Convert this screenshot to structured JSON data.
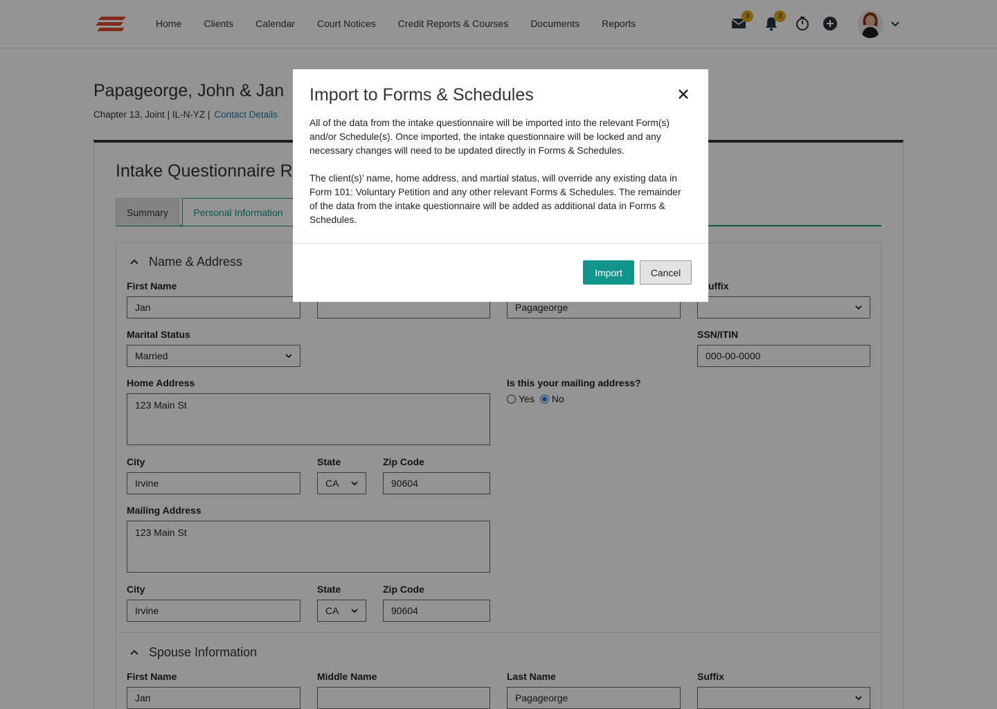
{
  "nav": {
    "links": [
      "Home",
      "Clients",
      "Calendar",
      "Court Notices",
      "Credit Reports & Courses",
      "Documents",
      "Reports"
    ],
    "mail_count": "3",
    "notification_count": "3",
    "icons": [
      "mail-icon",
      "bell-icon",
      "timer-icon",
      "add-icon",
      "user-avatar",
      "chevron-down-icon"
    ],
    "brand_color": "#e14b32"
  },
  "client": {
    "name": "Papageorge, John & Jan",
    "meta": "Chapter 13, Joint | IL-N-YZ |",
    "contact_link": "Contact Details"
  },
  "questionnaire": {
    "title": "Intake Questionnaire Re",
    "tabs": [
      "Summary",
      "Personal Information"
    ],
    "active_tab": "Personal Information"
  },
  "name_address": {
    "heading": "Name & Address",
    "first_name_label": "First Name",
    "first_name": "Jan",
    "middle_name": "",
    "last_name": "Pagageorge",
    "suffix_label": "uffix",
    "suffix": "",
    "marital_label": "Marital Status",
    "marital": "Married",
    "ssn_label": "SSN/ITIN",
    "ssn": "000-00-0000",
    "home_address_label": "Home Address",
    "home_address": "123 Main St",
    "mailing_question": "Is this your mailing address?",
    "yes_label": "Yes",
    "no_label": "No",
    "mailing_selected": "No",
    "city_label": "City",
    "city": "Irvine",
    "state_label": "State",
    "state": "CA",
    "zip_label": "Zip Code",
    "zip": "90604",
    "mailing_address_label": "Mailing Address",
    "mailing_address": "123 Main St",
    "mailing_city_label": "City",
    "mailing_city": "Irvine",
    "mailing_state_label": "State",
    "mailing_state": "CA",
    "mailing_zip_label": "Zip Code",
    "mailing_zip": "90604"
  },
  "spouse": {
    "heading": "Spouse Information",
    "first_name_label": "First Name",
    "first_name": "Jan",
    "middle_name_label": "Middle Name",
    "middle_name": "",
    "last_name_label": "Last Name",
    "last_name": "Pagageorge",
    "suffix_label": "Suffix",
    "suffix": ""
  },
  "modal": {
    "title": "Import to Forms & Schedules",
    "paragraph1": "All of the data from the intake questionnaire will be imported into the relevant Form(s) and/or Schedule(s). Once imported, the intake questionnaire will be locked and any necessary changes will need to be updated directly in Forms & Schedules.",
    "paragraph2": "The client(s)’ name, home address, and martial status, will override any existing data in Form 101: Voluntary Petition and any other relevant Forms & Schedules. The remainder of the data from the intake questionnaire will be added as additional data in Forms & Schedules.",
    "import_label": "Import",
    "cancel_label": "Cancel",
    "accent_color": "#11948c"
  }
}
